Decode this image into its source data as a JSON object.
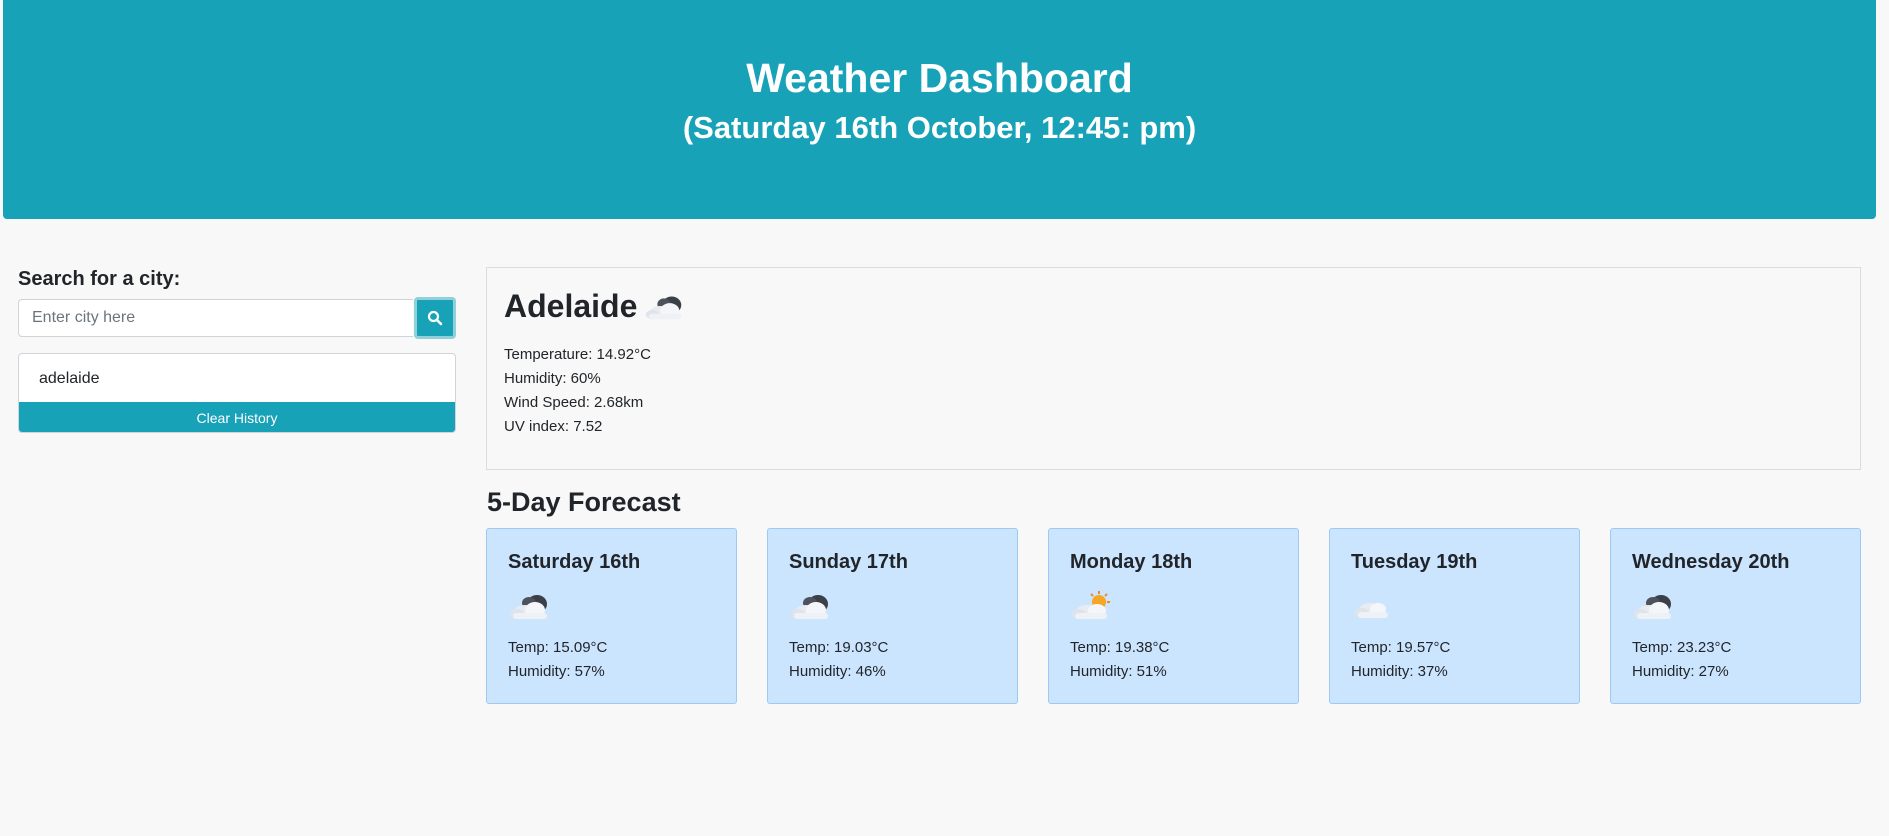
{
  "header": {
    "title": "Weather Dashboard",
    "datetime": "(Saturday 16th October, 12:45: pm)"
  },
  "search": {
    "label": "Search for a city:",
    "placeholder": "Enter city here",
    "value": "",
    "button_icon": "search-icon"
  },
  "history": {
    "items": [
      "adelaide"
    ],
    "clear_label": "Clear History"
  },
  "current": {
    "city": "Adelaide",
    "icon": "cloudy-icon",
    "temperature": "Temperature: 14.92°C",
    "humidity": "Humidity: 60%",
    "wind": "Wind Speed: 2.68km",
    "uv": "UV index: 7.52"
  },
  "forecast": {
    "title": "5-Day Forecast",
    "days": [
      {
        "day": "Saturday 16th",
        "icon": "cloudy-icon",
        "temp": "Temp: 15.09°C",
        "humidity": "Humidity: 57%"
      },
      {
        "day": "Sunday 17th",
        "icon": "cloudy-icon",
        "temp": "Temp: 19.03°C",
        "humidity": "Humidity: 46%"
      },
      {
        "day": "Monday 18th",
        "icon": "partly-sunny-icon",
        "temp": "Temp: 19.38°C",
        "humidity": "Humidity: 51%"
      },
      {
        "day": "Tuesday 19th",
        "icon": "light-cloud-icon",
        "temp": "Temp: 19.57°C",
        "humidity": "Humidity: 37%"
      },
      {
        "day": "Wednesday 20th",
        "icon": "cloudy-icon",
        "temp": "Temp: 23.23°C",
        "humidity": "Humidity: 27%"
      }
    ]
  },
  "colors": {
    "header_bg": "#17a2b8",
    "card_bg": "#cce5ff",
    "page_bg": "#f8f8f8"
  }
}
